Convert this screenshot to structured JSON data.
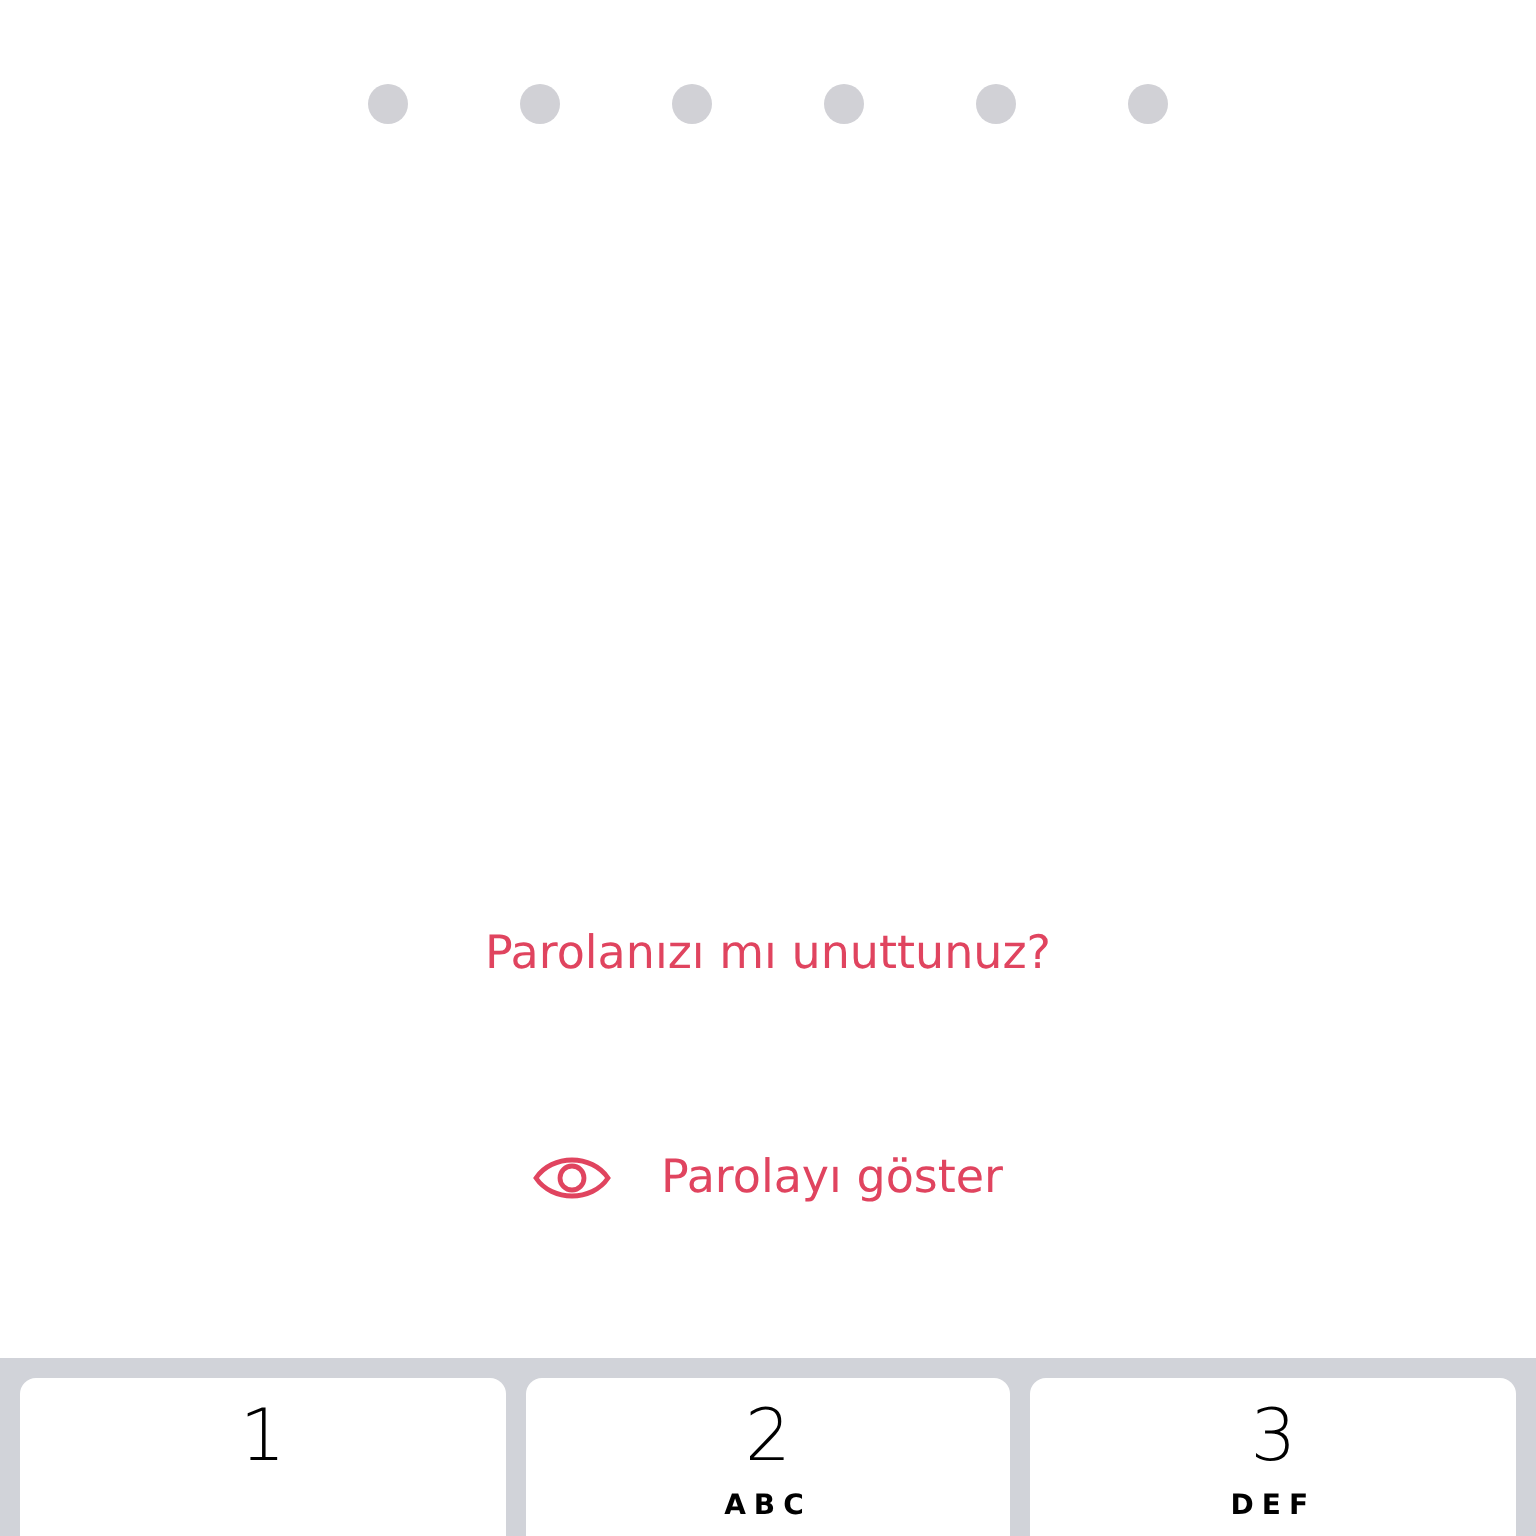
{
  "passcode_dots": [
    {
      "filled": false
    },
    {
      "filled": false
    },
    {
      "filled": false
    },
    {
      "filled": false
    },
    {
      "filled": false
    },
    {
      "filled": false
    }
  ],
  "forgot_link": "Parolanızı mı unuttunuz?",
  "show_password": {
    "label": "Parolayı göster",
    "on": false
  },
  "keypad": [
    {
      "digit": "1"
    },
    {
      "digit": "2",
      "letters": "ABC"
    },
    {
      "digit": "3",
      "letters": "DEF"
    }
  ]
}
